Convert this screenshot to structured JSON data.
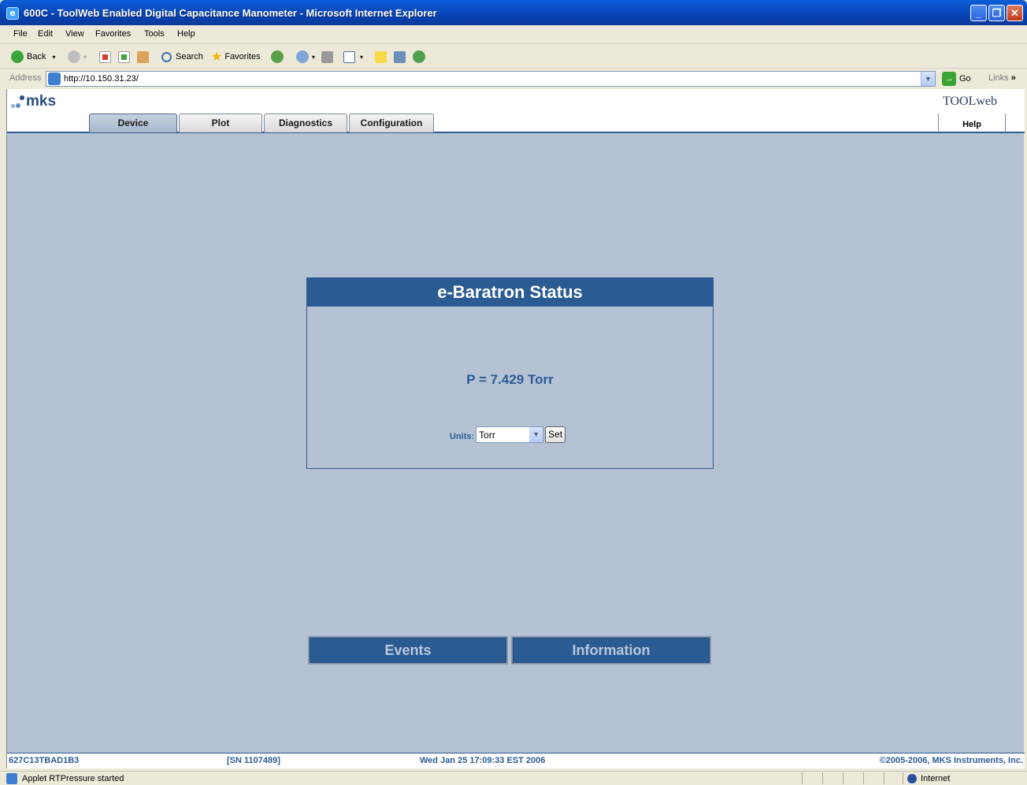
{
  "window": {
    "title": "600C - ToolWeb Enabled Digital Capacitance Manometer - Microsoft Internet Explorer",
    "controls": [
      "_",
      "❐",
      "✕"
    ]
  },
  "menu": [
    "File",
    "Edit",
    "View",
    "Favorites",
    "Tools",
    "Help"
  ],
  "toolbar": {
    "back_label": "Back",
    "search_label": "Search",
    "favorites_label": "Favorites"
  },
  "address": {
    "label": "Address",
    "url": "http://10.150.31.23/",
    "go_label": "Go",
    "links_label": "Links"
  },
  "header": {
    "logo": "mks",
    "tabs": [
      "Device",
      "Plot",
      "Diagnostics",
      "Configuration"
    ],
    "active_tab": "Device",
    "toolweb_logo": "TOOLweb",
    "help_label": "Help"
  },
  "status_panel": {
    "title": "e-Baratron Status",
    "pressure": "P = 7.429 Torr",
    "units_label": "Units:",
    "units_value": "Torr",
    "set_label": "Set"
  },
  "buttons": {
    "events": "Events",
    "information": "Information"
  },
  "footer": {
    "model": "627C13TBAD1B3",
    "serial": "[SN 1107489]",
    "datetime": "Wed Jan 25 17:09:33 EST 2006",
    "copyright": "©2005-2006, MKS Instruments, Inc."
  },
  "statusbar": {
    "message": "Applet RTPressure started",
    "zone": "Internet"
  },
  "colors": {
    "brand_blue": "#2b5b93",
    "page_bg": "#b4c2d4"
  }
}
